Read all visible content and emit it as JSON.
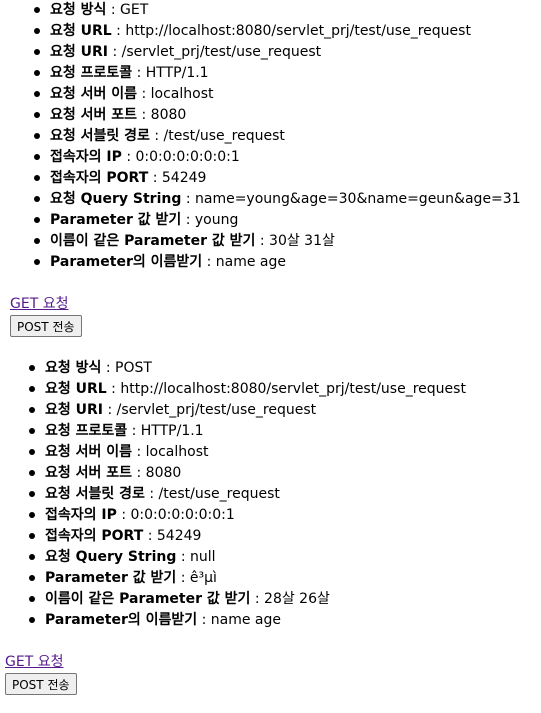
{
  "get_section": {
    "items": [
      {
        "label": "요청 방식",
        "value": "GET"
      },
      {
        "label": "요청 URL",
        "value": "http://localhost:8080/servlet_prj/test/use_request"
      },
      {
        "label": "요청 URI",
        "value": "/servlet_prj/test/use_request"
      },
      {
        "label": "요청 프로토콜",
        "value": "HTTP/1.1"
      },
      {
        "label": "요청 서버 이름",
        "value": "localhost"
      },
      {
        "label": "요청 서버 포트",
        "value": "8080"
      },
      {
        "label": "요청 서블릿 경로",
        "value": "/test/use_request"
      },
      {
        "label": "접속자의 IP",
        "value": "0:0:0:0:0:0:0:1"
      },
      {
        "label": "접속자의 PORT",
        "value": "54249"
      },
      {
        "label": "요청 Query String",
        "value": "name=young&age=30&name=geun&age=31"
      },
      {
        "label": "Parameter 값 받기",
        "value": "young"
      },
      {
        "label": "이름이 같은 Parameter 값 받기",
        "value": "30살 31살"
      },
      {
        "label": "Parameter의 이름받기",
        "value": "name age"
      }
    ],
    "get_link_label": "GET 요청",
    "post_button_label": "POST 전송"
  },
  "post_section": {
    "items": [
      {
        "label": "요청 방식",
        "value": "POST"
      },
      {
        "label": "요청 URL",
        "value": "http://localhost:8080/servlet_prj/test/use_request"
      },
      {
        "label": "요청 URI",
        "value": "/servlet_prj/test/use_request"
      },
      {
        "label": "요청 프로토콜",
        "value": "HTTP/1.1"
      },
      {
        "label": "요청 서버 이름",
        "value": "localhost"
      },
      {
        "label": "요청 서버 포트",
        "value": "8080"
      },
      {
        "label": "요청 서블릿 경로",
        "value": "/test/use_request"
      },
      {
        "label": "접속자의 IP",
        "value": "0:0:0:0:0:0:0:1"
      },
      {
        "label": "접속자의 PORT",
        "value": "54249"
      },
      {
        "label": "요청 Query String",
        "value": "null"
      },
      {
        "label": "Parameter 값 받기",
        "value": "ê³µì "
      },
      {
        "label": "이름이 같은 Parameter 값 받기",
        "value": "28살 26살"
      },
      {
        "label": "Parameter의 이름받기",
        "value": "name age"
      }
    ],
    "get_link_label": "GET 요청",
    "post_button_label": "POST 전송"
  },
  "separator": " : "
}
